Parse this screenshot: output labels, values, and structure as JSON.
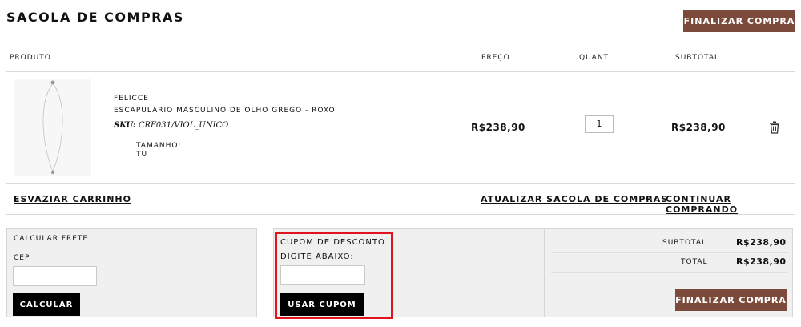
{
  "header": {
    "title": "SACOLA DE COMPRAS",
    "checkout_label": "FINALIZAR COMPRA"
  },
  "table": {
    "headers": {
      "product": "PRODUTO",
      "price": "PREÇO",
      "quantity": "QUANT.",
      "subtotal": "SUBTOTAL"
    },
    "item": {
      "brand": "FELICCE",
      "name": "ESCAPULÁRIO MASCULINO DE OLHO GREGO - ROXO",
      "sku_label": "SKU:",
      "sku_value": "CRF031/VIOL_UNICO",
      "size_label": "TAMANHO:",
      "size_value": "TU",
      "price": "R$238,90",
      "quantity": "1",
      "subtotal": "R$238,90",
      "remove_icon": "trash-icon"
    }
  },
  "actions": {
    "empty_cart": "ESVAZIAR CARRINHO",
    "update_bag": "ATUALIZAR SACOLA DE COMPRAS",
    "or": "-OU-",
    "continue_shopping": "CONTINUAR COMPRANDO"
  },
  "shipping": {
    "title": "CALCULAR FRETE",
    "cep_label": "CEP",
    "cep_value": "",
    "button": "CALCULAR"
  },
  "coupon": {
    "title": "CUPOM DE DESCONTO",
    "subtitle": "DIGITE ABAIXO:",
    "value": "",
    "button": "USAR CUPOM"
  },
  "summary": {
    "subtotal_label": "SUBTOTAL",
    "subtotal_value": "R$238,90",
    "total_label": "TOTAL",
    "total_value": "R$238,90",
    "checkout_label": "FINALIZAR COMPRA"
  },
  "colors": {
    "brand_button": "#7b4a3b",
    "highlight": "#e0141c"
  }
}
